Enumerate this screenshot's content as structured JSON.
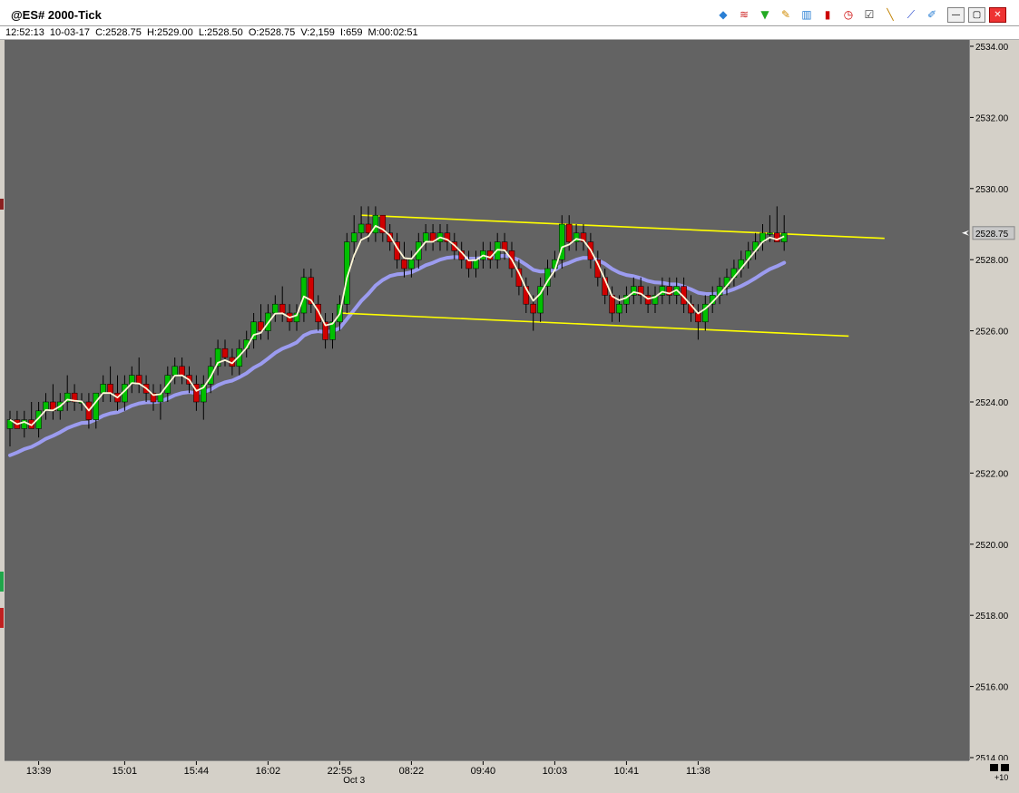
{
  "window": {
    "title": "@ES# 2000-Tick",
    "info_line": "12:52:13  10-03-17  C:2528.75  H:2529.00  L:2528.50  O:2528.75  V:2,159  I:659  M:00:02:51",
    "zoom_label": "+10"
  },
  "toolbar": [
    {
      "name": "layers-icon",
      "glyph": "◆",
      "color": "#2a7fd4"
    },
    {
      "name": "rainbow-icon",
      "glyph": "≋",
      "color": "#cc2222"
    },
    {
      "name": "funnel-icon",
      "glyph": "▼",
      "color": "#22aa22"
    },
    {
      "name": "pencil-icon",
      "glyph": "✎",
      "color": "#d08a00"
    },
    {
      "name": "bar-chart-icon",
      "glyph": "▥",
      "color": "#2a7fd4"
    },
    {
      "name": "candlestick-icon",
      "glyph": "▮",
      "color": "#cc0000"
    },
    {
      "name": "clock-icon",
      "glyph": "◷",
      "color": "#cc0000"
    },
    {
      "name": "list-check-icon",
      "glyph": "☑",
      "color": "#333333"
    },
    {
      "name": "draw-line-icon",
      "glyph": "╲",
      "color": "#c08000"
    },
    {
      "name": "trend-line-icon",
      "glyph": "⟋",
      "color": "#2244cc"
    },
    {
      "name": "brush-icon",
      "glyph": "✐",
      "color": "#2a7fd4"
    }
  ],
  "window_controls": {
    "minimize": "—",
    "restore": "▢",
    "close": "✕"
  },
  "colors": {
    "background": "#636363",
    "up_candle": "#00c000",
    "down_candle": "#d00000",
    "wick": "#000000",
    "fast_ma": "#fff8d8",
    "slow_ma": "#9c9cf0",
    "channel": "#ffff00"
  },
  "chart_data": {
    "type": "candlestick",
    "ylim": [
      2514,
      2534
    ],
    "yticks": [
      2514,
      2516,
      2518,
      2520,
      2522,
      2524,
      2526,
      2528,
      2530,
      2532,
      2534
    ],
    "ytick_labels": [
      "2514.00",
      "2516.00",
      "2518.00",
      "2520.00",
      "2522.00",
      "2524.00",
      "2526.00",
      "2528.00",
      "2530.00",
      "2532.00",
      "2534.00"
    ],
    "xlabels": [
      {
        "bar": 4,
        "label": "13:39"
      },
      {
        "bar": 16,
        "label": "15:01"
      },
      {
        "bar": 26,
        "label": "15:44"
      },
      {
        "bar": 36,
        "label": "16:02"
      },
      {
        "bar": 46,
        "label": "22:55"
      },
      {
        "bar": 56,
        "label": "08:22"
      },
      {
        "bar": 66,
        "label": "09:40"
      },
      {
        "bar": 76,
        "label": "10:03"
      },
      {
        "bar": 86,
        "label": "10:41"
      },
      {
        "bar": 96,
        "label": "11:38"
      }
    ],
    "date_label": {
      "bar": 48,
      "label": "Oct 3"
    },
    "last_price": 2528.75,
    "last_price_label": "2528.75",
    "channel_upper": {
      "start_bar": 49,
      "start_price": 2529.25,
      "end_bar": 122,
      "end_price": 2528.6
    },
    "channel_lower": {
      "start_bar": 46,
      "start_price": 2526.5,
      "end_bar": 117,
      "end_price": 2525.85
    },
    "bars": [
      [
        2523.25,
        2523.75,
        2522.75,
        2523.5
      ],
      [
        2523.5,
        2523.75,
        2523.25,
        2523.25
      ],
      [
        2523.25,
        2523.75,
        2523.0,
        2523.5
      ],
      [
        2523.5,
        2524.0,
        2523.25,
        2523.25
      ],
      [
        2523.25,
        2524.0,
        2523.0,
        2523.75
      ],
      [
        2523.75,
        2524.25,
        2523.5,
        2524.0
      ],
      [
        2524.0,
        2524.5,
        2523.5,
        2523.75
      ],
      [
        2523.75,
        2524.25,
        2523.5,
        2524.0
      ],
      [
        2524.0,
        2524.75,
        2523.75,
        2524.25
      ],
      [
        2524.25,
        2524.5,
        2523.75,
        2524.0
      ],
      [
        2524.0,
        2524.25,
        2523.75,
        2524.0
      ],
      [
        2524.0,
        2524.25,
        2523.25,
        2523.5
      ],
      [
        2523.5,
        2524.25,
        2523.25,
        2524.25
      ],
      [
        2524.25,
        2524.75,
        2524.0,
        2524.5
      ],
      [
        2524.5,
        2525.0,
        2524.0,
        2524.25
      ],
      [
        2524.25,
        2524.75,
        2523.75,
        2524.0
      ],
      [
        2524.0,
        2524.75,
        2523.75,
        2524.5
      ],
      [
        2524.5,
        2525.0,
        2524.25,
        2524.75
      ],
      [
        2524.75,
        2525.25,
        2524.25,
        2524.5
      ],
      [
        2524.5,
        2524.75,
        2524.0,
        2524.25
      ],
      [
        2524.25,
        2524.5,
        2523.75,
        2524.0
      ],
      [
        2524.0,
        2524.5,
        2523.5,
        2524.25
      ],
      [
        2524.25,
        2525.0,
        2524.0,
        2524.75
      ],
      [
        2524.75,
        2525.25,
        2524.5,
        2525.0
      ],
      [
        2525.0,
        2525.25,
        2524.5,
        2524.75
      ],
      [
        2524.75,
        2525.0,
        2524.25,
        2524.5
      ],
      [
        2524.5,
        2524.75,
        2523.75,
        2524.0
      ],
      [
        2524.0,
        2524.75,
        2523.5,
        2524.5
      ],
      [
        2524.5,
        2525.25,
        2524.25,
        2525.0
      ],
      [
        2525.0,
        2525.75,
        2524.75,
        2525.5
      ],
      [
        2525.5,
        2525.75,
        2525.0,
        2525.25
      ],
      [
        2525.25,
        2525.5,
        2524.75,
        2525.0
      ],
      [
        2525.0,
        2525.75,
        2524.75,
        2525.5
      ],
      [
        2525.5,
        2526.0,
        2525.25,
        2525.75
      ],
      [
        2525.75,
        2526.5,
        2525.5,
        2526.25
      ],
      [
        2526.25,
        2526.75,
        2525.75,
        2526.0
      ],
      [
        2526.0,
        2526.75,
        2525.75,
        2526.5
      ],
      [
        2526.5,
        2527.0,
        2526.25,
        2526.75
      ],
      [
        2526.75,
        2527.25,
        2526.25,
        2526.5
      ],
      [
        2526.5,
        2526.75,
        2526.0,
        2526.25
      ],
      [
        2526.25,
        2526.75,
        2526.0,
        2526.5
      ],
      [
        2526.5,
        2527.75,
        2526.25,
        2527.5
      ],
      [
        2527.5,
        2527.75,
        2526.5,
        2526.75
      ],
      [
        2526.75,
        2527.0,
        2526.0,
        2526.25
      ],
      [
        2526.25,
        2526.5,
        2525.5,
        2525.75
      ],
      [
        2525.75,
        2526.5,
        2525.5,
        2526.25
      ],
      [
        2526.25,
        2527.0,
        2526.0,
        2526.75
      ],
      [
        2526.75,
        2528.75,
        2526.5,
        2528.5
      ],
      [
        2528.5,
        2529.25,
        2528.0,
        2528.75
      ],
      [
        2528.75,
        2529.5,
        2528.5,
        2529.0
      ],
      [
        2529.0,
        2529.5,
        2528.5,
        2528.75
      ],
      [
        2528.75,
        2529.5,
        2528.5,
        2529.25
      ],
      [
        2529.25,
        2529.25,
        2528.5,
        2528.75
      ],
      [
        2528.75,
        2529.0,
        2528.25,
        2528.5
      ],
      [
        2528.5,
        2528.75,
        2527.75,
        2528.0
      ],
      [
        2528.0,
        2528.5,
        2527.5,
        2527.75
      ],
      [
        2527.75,
        2528.25,
        2527.5,
        2528.0
      ],
      [
        2528.0,
        2528.75,
        2527.75,
        2528.5
      ],
      [
        2528.5,
        2529.0,
        2528.25,
        2528.75
      ],
      [
        2528.75,
        2529.0,
        2528.25,
        2528.5
      ],
      [
        2528.5,
        2529.0,
        2528.25,
        2528.75
      ],
      [
        2528.75,
        2529.0,
        2528.25,
        2528.5
      ],
      [
        2528.5,
        2528.75,
        2528.0,
        2528.25
      ],
      [
        2528.25,
        2528.5,
        2527.75,
        2528.0
      ],
      [
        2528.0,
        2528.25,
        2527.5,
        2527.75
      ],
      [
        2527.75,
        2528.25,
        2527.5,
        2528.0
      ],
      [
        2528.0,
        2528.5,
        2527.75,
        2528.25
      ],
      [
        2528.25,
        2528.5,
        2527.75,
        2528.0
      ],
      [
        2528.0,
        2528.75,
        2527.75,
        2528.5
      ],
      [
        2528.5,
        2528.75,
        2528.0,
        2528.25
      ],
      [
        2528.25,
        2528.5,
        2527.5,
        2527.75
      ],
      [
        2527.75,
        2528.0,
        2527.0,
        2527.25
      ],
      [
        2527.25,
        2527.5,
        2526.5,
        2526.75
      ],
      [
        2526.75,
        2527.0,
        2526.0,
        2526.5
      ],
      [
        2526.5,
        2527.5,
        2526.25,
        2527.25
      ],
      [
        2527.25,
        2528.0,
        2527.0,
        2527.75
      ],
      [
        2527.75,
        2528.25,
        2527.5,
        2528.0
      ],
      [
        2528.0,
        2529.25,
        2527.75,
        2529.0
      ],
      [
        2529.0,
        2529.25,
        2528.25,
        2528.5
      ],
      [
        2528.5,
        2529.0,
        2528.25,
        2528.75
      ],
      [
        2528.75,
        2529.0,
        2528.25,
        2528.5
      ],
      [
        2528.5,
        2528.75,
        2527.75,
        2528.0
      ],
      [
        2528.0,
        2528.25,
        2527.25,
        2527.5
      ],
      [
        2527.5,
        2527.75,
        2526.75,
        2527.0
      ],
      [
        2527.0,
        2527.25,
        2526.25,
        2526.5
      ],
      [
        2526.5,
        2527.0,
        2526.25,
        2526.75
      ],
      [
        2526.75,
        2527.25,
        2526.5,
        2527.0
      ],
      [
        2527.0,
        2527.5,
        2526.75,
        2527.25
      ],
      [
        2527.25,
        2527.5,
        2526.75,
        2527.0
      ],
      [
        2527.0,
        2527.25,
        2526.5,
        2526.75
      ],
      [
        2526.75,
        2527.25,
        2526.5,
        2527.0
      ],
      [
        2527.0,
        2527.5,
        2526.75,
        2527.25
      ],
      [
        2527.25,
        2527.5,
        2526.75,
        2527.0
      ],
      [
        2527.0,
        2527.5,
        2526.75,
        2527.25
      ],
      [
        2527.25,
        2527.5,
        2526.5,
        2526.75
      ],
      [
        2526.75,
        2527.0,
        2526.25,
        2526.5
      ],
      [
        2526.5,
        2526.75,
        2525.75,
        2526.25
      ],
      [
        2526.25,
        2527.0,
        2526.0,
        2526.75
      ],
      [
        2526.75,
        2527.25,
        2526.5,
        2527.0
      ],
      [
        2527.0,
        2527.5,
        2526.75,
        2527.25
      ],
      [
        2527.25,
        2527.75,
        2527.0,
        2527.5
      ],
      [
        2527.5,
        2528.0,
        2527.25,
        2527.75
      ],
      [
        2527.75,
        2528.25,
        2527.5,
        2528.0
      ],
      [
        2528.0,
        2528.5,
        2527.75,
        2528.25
      ],
      [
        2528.25,
        2528.75,
        2528.0,
        2528.5
      ],
      [
        2528.5,
        2529.0,
        2528.25,
        2528.75
      ],
      [
        2528.75,
        2529.25,
        2528.5,
        2528.75
      ],
      [
        2528.75,
        2529.5,
        2528.5,
        2528.5
      ],
      [
        2528.5,
        2529.25,
        2528.25,
        2528.75
      ]
    ]
  }
}
